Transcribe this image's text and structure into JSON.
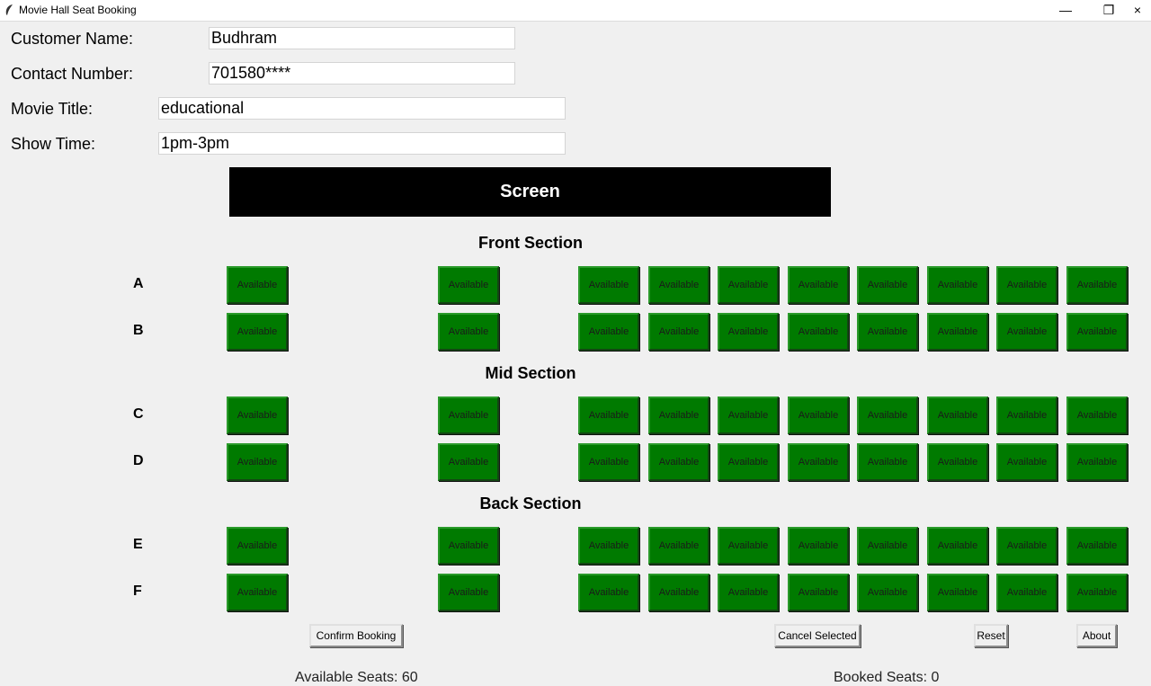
{
  "window": {
    "title": "Movie Hall Seat Booking",
    "minimize": "—",
    "maximize": "❐",
    "close": "×"
  },
  "form": {
    "customer_name_label": "Customer Name:",
    "customer_name_value": "Budhram",
    "contact_label": "Contact Number:",
    "contact_value": "701580****",
    "movie_label": "Movie Title:",
    "movie_value": "educational",
    "showtime_label": "Show Time:",
    "showtime_value": "1pm-3pm"
  },
  "screen_label": "Screen",
  "sections": [
    {
      "title": "Front Section",
      "rows": [
        "A",
        "B"
      ]
    },
    {
      "title": "Mid Section",
      "rows": [
        "C",
        "D"
      ]
    },
    {
      "title": "Back Section",
      "rows": [
        "E",
        "F"
      ]
    }
  ],
  "seat_label": "Available",
  "seat_color": "#007a00",
  "seats_per_row": 10,
  "buttons": {
    "confirm": "Confirm Booking",
    "cancel": "Cancel Selected",
    "reset": "Reset",
    "about": "About"
  },
  "status": {
    "available": "Available Seats: 60",
    "booked": "Booked Seats: 0"
  }
}
